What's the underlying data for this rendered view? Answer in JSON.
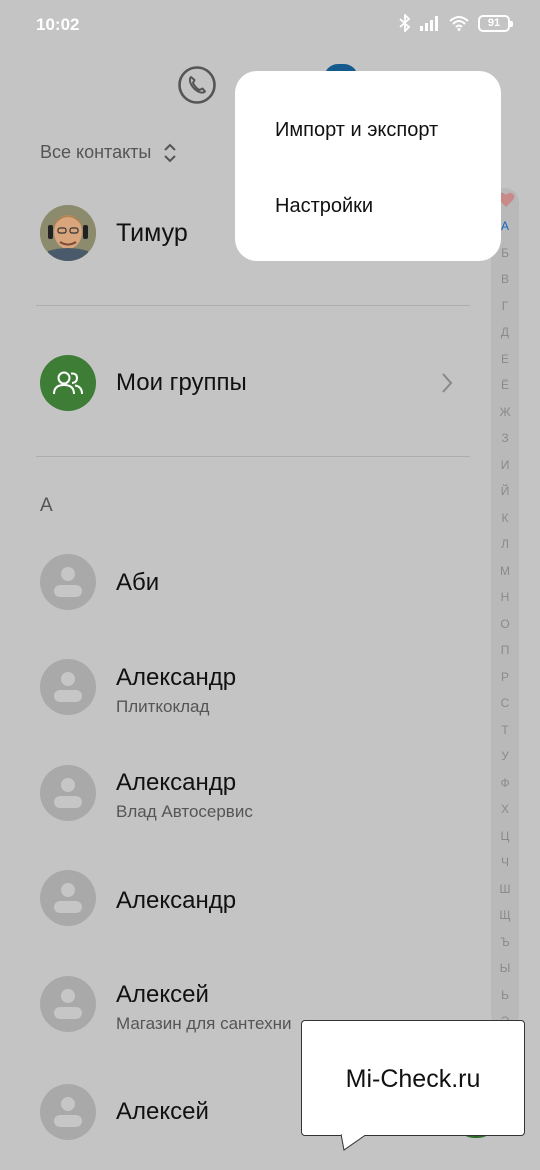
{
  "status_bar": {
    "time": "10:02",
    "battery": "91"
  },
  "tabs": {
    "phone_icon": "phone-icon",
    "contacts_icon": "contacts-icon"
  },
  "filter": {
    "label": "Все контакты"
  },
  "profile": {
    "name": "Тимур"
  },
  "groups": {
    "label": "Мои группы"
  },
  "section_letter": "А",
  "contacts": [
    {
      "name": "Аби",
      "subtitle": ""
    },
    {
      "name": "Александр",
      "subtitle": "Плиткоклад"
    },
    {
      "name": "Александр",
      "subtitle": "Влад Автосервис"
    },
    {
      "name": "Александр",
      "subtitle": ""
    },
    {
      "name": "Алексей",
      "subtitle": "Магазин для сантехни"
    },
    {
      "name": "Алексей",
      "subtitle": ""
    }
  ],
  "alphabet": [
    "А",
    "Б",
    "В",
    "Г",
    "Д",
    "Е",
    "Ё",
    "Ж",
    "З",
    "И",
    "Й",
    "К",
    "Л",
    "М",
    "Н",
    "О",
    "П",
    "Р",
    "С",
    "Т",
    "У",
    "Ф",
    "Х",
    "Ц",
    "Ч",
    "Ш",
    "Щ",
    "Ъ",
    "Ы",
    "Ь",
    "Э"
  ],
  "alphabet_active": "А",
  "menu": {
    "items": [
      "Импорт и экспорт",
      "Настройки"
    ]
  },
  "watermark": {
    "text": "Mi-Check.ru"
  },
  "colors": {
    "accent": "#1565c0",
    "groups": "#3d7d36",
    "dim_overlay": "#c4c4c4"
  }
}
